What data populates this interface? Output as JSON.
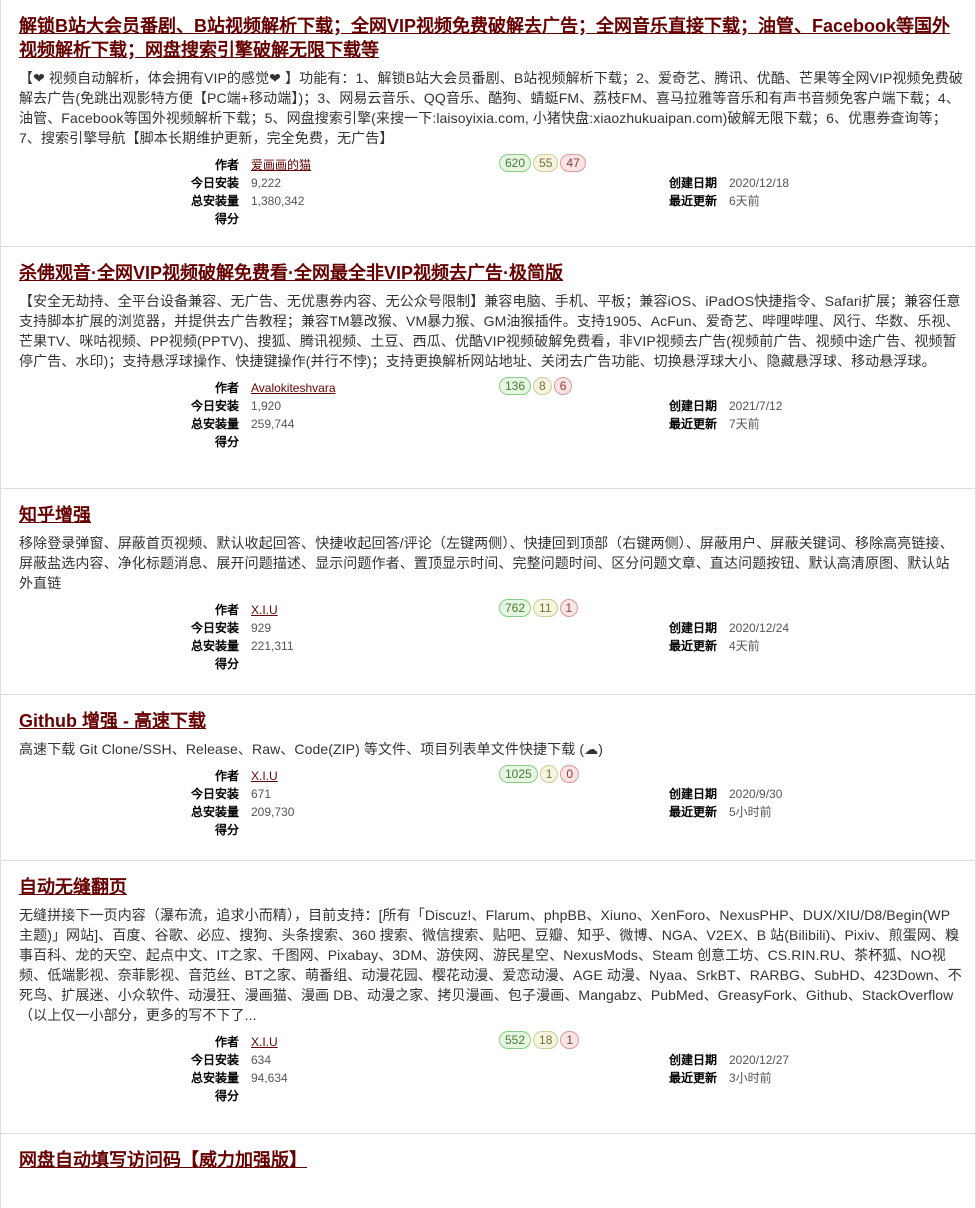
{
  "labels": {
    "author": "作者",
    "daily": "今日安装",
    "total": "总安装量",
    "score": "得分",
    "created": "创建日期",
    "updated": "最近更新"
  },
  "scripts": [
    {
      "title": "解锁B站大会员番剧、B站视频解析下载；全网VIP视频免费破解去广告；全网音乐直接下载；油管、Facebook等国外视频解析下载；网盘搜索引擎破解无限下载等",
      "desc": "【❤ 视频自动解析，体会拥有VIP的感觉❤ 】功能有：1、解锁B站大会员番剧、B站视频解析下载；2、爱奇艺、腾讯、优酷、芒果等全网VIP视频免费破解去广告(免跳出观影特方便【PC端+移动端】)；3、网易云音乐、QQ音乐、酷狗、蜻蜓FM、荔枝FM、喜马拉雅等音乐和有声书音频免客户端下载；4、油管、Facebook等国外视频解析下载；5、网盘搜索引擎(来搜一下:laisoyixia.com, 小猪快盘:xiaozhukuaipan.com)破解无限下载；6、优惠券查询等；7、搜索引擎导航【脚本长期维护更新，完全免费，无广告】",
      "author": "爱画画的猫",
      "daily": "9,222",
      "total": "1,380,342",
      "good": "620",
      "ok": "55",
      "bad": "47",
      "created": "2020/12/18",
      "updated": "6天前"
    },
    {
      "title": "杀佛观音·全网VIP视频破解免费看·全网最全非VIP视频去广告·极简版",
      "desc": "【安全无劫持、全平台设备兼容、无广告、无优惠券内容、无公众号限制】兼容电脑、手机、平板；兼容iOS、iPadOS快捷指令、Safari扩展；兼容任意支持脚本扩展的浏览器，并提供去广告教程；兼容TM篡改猴、VM暴力猴、GM油猴插件。支持1905、AcFun、爱奇艺、哔哩哔哩、风行、华数、乐视、芒果TV、咪咕视频、PP视频(PPTV)、搜狐、腾讯视频、土豆、西瓜、优酷VIP视频破解免费看，非VIP视频去广告(视频前广告、视频中途广告、视频暂停广告、水印)；支持悬浮球操作、快捷键操作(并行不悖)；支持更换解析网站地址、关闭去广告功能、切换悬浮球大小、隐藏悬浮球、移动悬浮球。",
      "author": "Avalokiteshvara",
      "daily": "1,920",
      "total": "259,744",
      "good": "136",
      "ok": "8",
      "bad": "6",
      "created": "2021/7/12",
      "updated": "7天前"
    },
    {
      "title": "知乎增强",
      "desc": "移除登录弹窗、屏蔽首页视频、默认收起回答、快捷收起回答/评论（左键两侧）、快捷回到顶部（右键两侧）、屏蔽用户、屏蔽关键词、移除高亮链接、屏蔽盐选内容、净化标题消息、展开问题描述、显示问题作者、置顶显示时间、完整问题时间、区分问题文章、直达问题按钮、默认高清原图、默认站外直链",
      "author": "X.I.U",
      "daily": "929",
      "total": "221,311",
      "good": "762",
      "ok": "11",
      "bad": "1",
      "created": "2020/12/24",
      "updated": "4天前"
    },
    {
      "title": "Github 增强 - 高速下载",
      "desc": "高速下载 Git Clone/SSH、Release、Raw、Code(ZIP) 等文件、项目列表单文件快捷下载 (☁)",
      "author": "X.I.U",
      "daily": "671",
      "total": "209,730",
      "good": "1025",
      "ok": "1",
      "bad": "0",
      "created": "2020/9/30",
      "updated": "5小时前"
    },
    {
      "title": "自动无缝翻页",
      "desc": "无缝拼接下一页内容（瀑布流，追求小而精），目前支持：[所有「Discuz!、Flarum、phpBB、Xiuno、XenForo、NexusPHP、DUX/XIU/D8/Begin(WP主题)」网站]、百度、谷歌、必应、搜狗、头条搜索、360 搜索、微信搜索、贴吧、豆瓣、知乎、微博、NGA、V2EX、B 站(Bilibili)、Pixiv、煎蛋网、糗事百科、龙的天空、起点中文、IT之家、千图网、Pixabay、3DM、游侠网、游民星空、NexusMods、Steam 创意工坊、CS.RIN.RU、茶杯狐、NO视频、低端影视、奈菲影视、音范丝、BT之家、萌番组、动漫花园、樱花动漫、爱恋动漫、AGE 动漫、Nyaa、SrkBT、RARBG、SubHD、423Down、不死鸟、扩展迷、小众软件、动漫狂、漫画猫、漫画 DB、动漫之家、拷贝漫画、包子漫画、Mangabz、PubMed、GreasyFork、Github、StackOverflow（以上仅一小部分，更多的写不下了...",
      "author": "X.I.U",
      "daily": "634",
      "total": "94,634",
      "good": "552",
      "ok": "18",
      "bad": "1",
      "created": "2020/12/27",
      "updated": "3小时前"
    },
    {
      "title": "网盘自动填写访问码【威力加强版】"
    }
  ]
}
